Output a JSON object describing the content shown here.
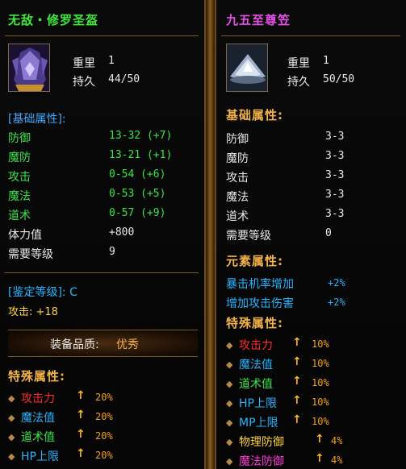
{
  "left": {
    "title": "无敌・修罗圣盔",
    "weight_label": "重里",
    "weight_value": "1",
    "durability_label": "持久",
    "durability_value": "44/50",
    "basic_header": "[基础属性]:",
    "stats": [
      {
        "label": "防御",
        "value": "13-32 (+7)"
      },
      {
        "label": "魔防",
        "value": "13-21 (+1)"
      },
      {
        "label": "攻击",
        "value": "0-54 (+6)"
      },
      {
        "label": "魔法",
        "value": "0-53 (+5)"
      },
      {
        "label": "道术",
        "value": "0-57 (+9)"
      }
    ],
    "hp_label": "体力值",
    "hp_value": "+800",
    "level_label": "需要等级",
    "level_value": "9",
    "appraise": "[鉴定等级]: C",
    "attack_bonus": "攻击: +18",
    "quality_label": "装备品质:",
    "quality_value": "优秀",
    "special_header": "特殊属性:",
    "special": [
      {
        "label": "攻击力",
        "value": "20%",
        "color": "#ff2a2a"
      },
      {
        "label": "魔法值",
        "value": "20%",
        "color": "#27b5ff"
      },
      {
        "label": "道术值",
        "value": "20%",
        "color": "#3be34a"
      },
      {
        "label": "HP上限",
        "value": "20%",
        "color": "#27b5ff"
      }
    ]
  },
  "right": {
    "title": "九五至尊笠",
    "weight_label": "重里",
    "weight_value": "1",
    "durability_label": "持久",
    "durability_value": "50/50",
    "basic_header": "基础属性:",
    "stats": [
      {
        "label": "防御",
        "value": "3-3"
      },
      {
        "label": "魔防",
        "value": "3-3"
      },
      {
        "label": "攻击",
        "value": "3-3"
      },
      {
        "label": "魔法",
        "value": "3-3"
      },
      {
        "label": "道术",
        "value": "3-3"
      },
      {
        "label": "需要等级",
        "value": "0"
      }
    ],
    "element_header": "元素属性:",
    "elements": [
      {
        "label": "暴击机率增加",
        "value": "+2%"
      },
      {
        "label": "增加攻击伤害",
        "value": "+2%"
      }
    ],
    "special_header": "特殊属性:",
    "special": [
      {
        "label": "攻击力",
        "value": "10%",
        "color": "#ff2a2a"
      },
      {
        "label": "魔法值",
        "value": "10%",
        "color": "#27b5ff"
      },
      {
        "label": "道术值",
        "value": "10%",
        "color": "#3be34a"
      },
      {
        "label": "HP上限",
        "value": "10%",
        "color": "#27b5ff"
      },
      {
        "label": "MP上限",
        "value": "10%",
        "color": "#27b5ff"
      },
      {
        "label": "物理防御",
        "value": "4%",
        "color": "#ffd23a"
      },
      {
        "label": "魔法防御",
        "value": "4%",
        "color": "#ff3ad8"
      }
    ]
  },
  "colors": {
    "accent": "#f2b24a",
    "border": "#6b4a1c"
  },
  "icons": {
    "bullet": "diamond-bullet-icon",
    "arrow": "up-arrow-icon"
  }
}
